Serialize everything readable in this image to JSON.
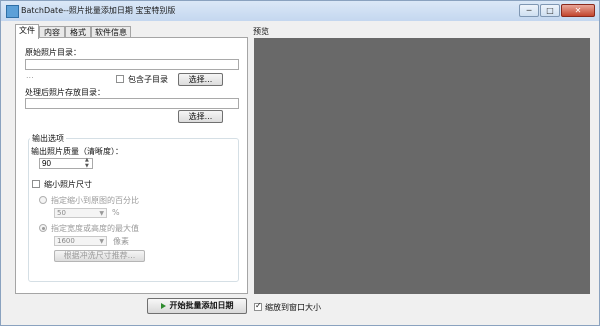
{
  "window": {
    "title": "BatchDate--照片批量添加日期 宝宝特别版"
  },
  "window_buttons": {
    "minimize": "─",
    "maximize": "□",
    "close": "✕"
  },
  "tabs": [
    "文件",
    "内容",
    "格式",
    "软件信息"
  ],
  "file_tab": {
    "source_label": "原始照片目录：",
    "source_value": "",
    "hint": "...",
    "include_subdirs_label": "包含子目录",
    "include_subdirs_checked": false,
    "browse1_label": "选择...",
    "output_label": "处理后照片存放目录：",
    "output_value": "",
    "browse2_label": "选择..."
  },
  "output_options": {
    "group_label": "输出选项",
    "quality_label": "输出照片质量（清晰度）：",
    "quality_value": "90",
    "resize_label": "缩小照片尺寸",
    "resize_checked": false,
    "percent_label": "指定缩小到原图的百分比",
    "percent_value": "50",
    "percent_unit": "%",
    "percent_selected": false,
    "maxdim_label": "指定宽度或高度的最大值",
    "maxdim_selected": true,
    "maxdim_value": "1600",
    "maxdim_unit": "像素",
    "recommend_button": "根据冲洗尺寸推荐..."
  },
  "preview": {
    "label": "预览",
    "bg_color": "#696969"
  },
  "footer": {
    "start_button": "开始批量添加日期",
    "fit_window_label": "缩放到窗口大小",
    "fit_window_checked": true
  }
}
